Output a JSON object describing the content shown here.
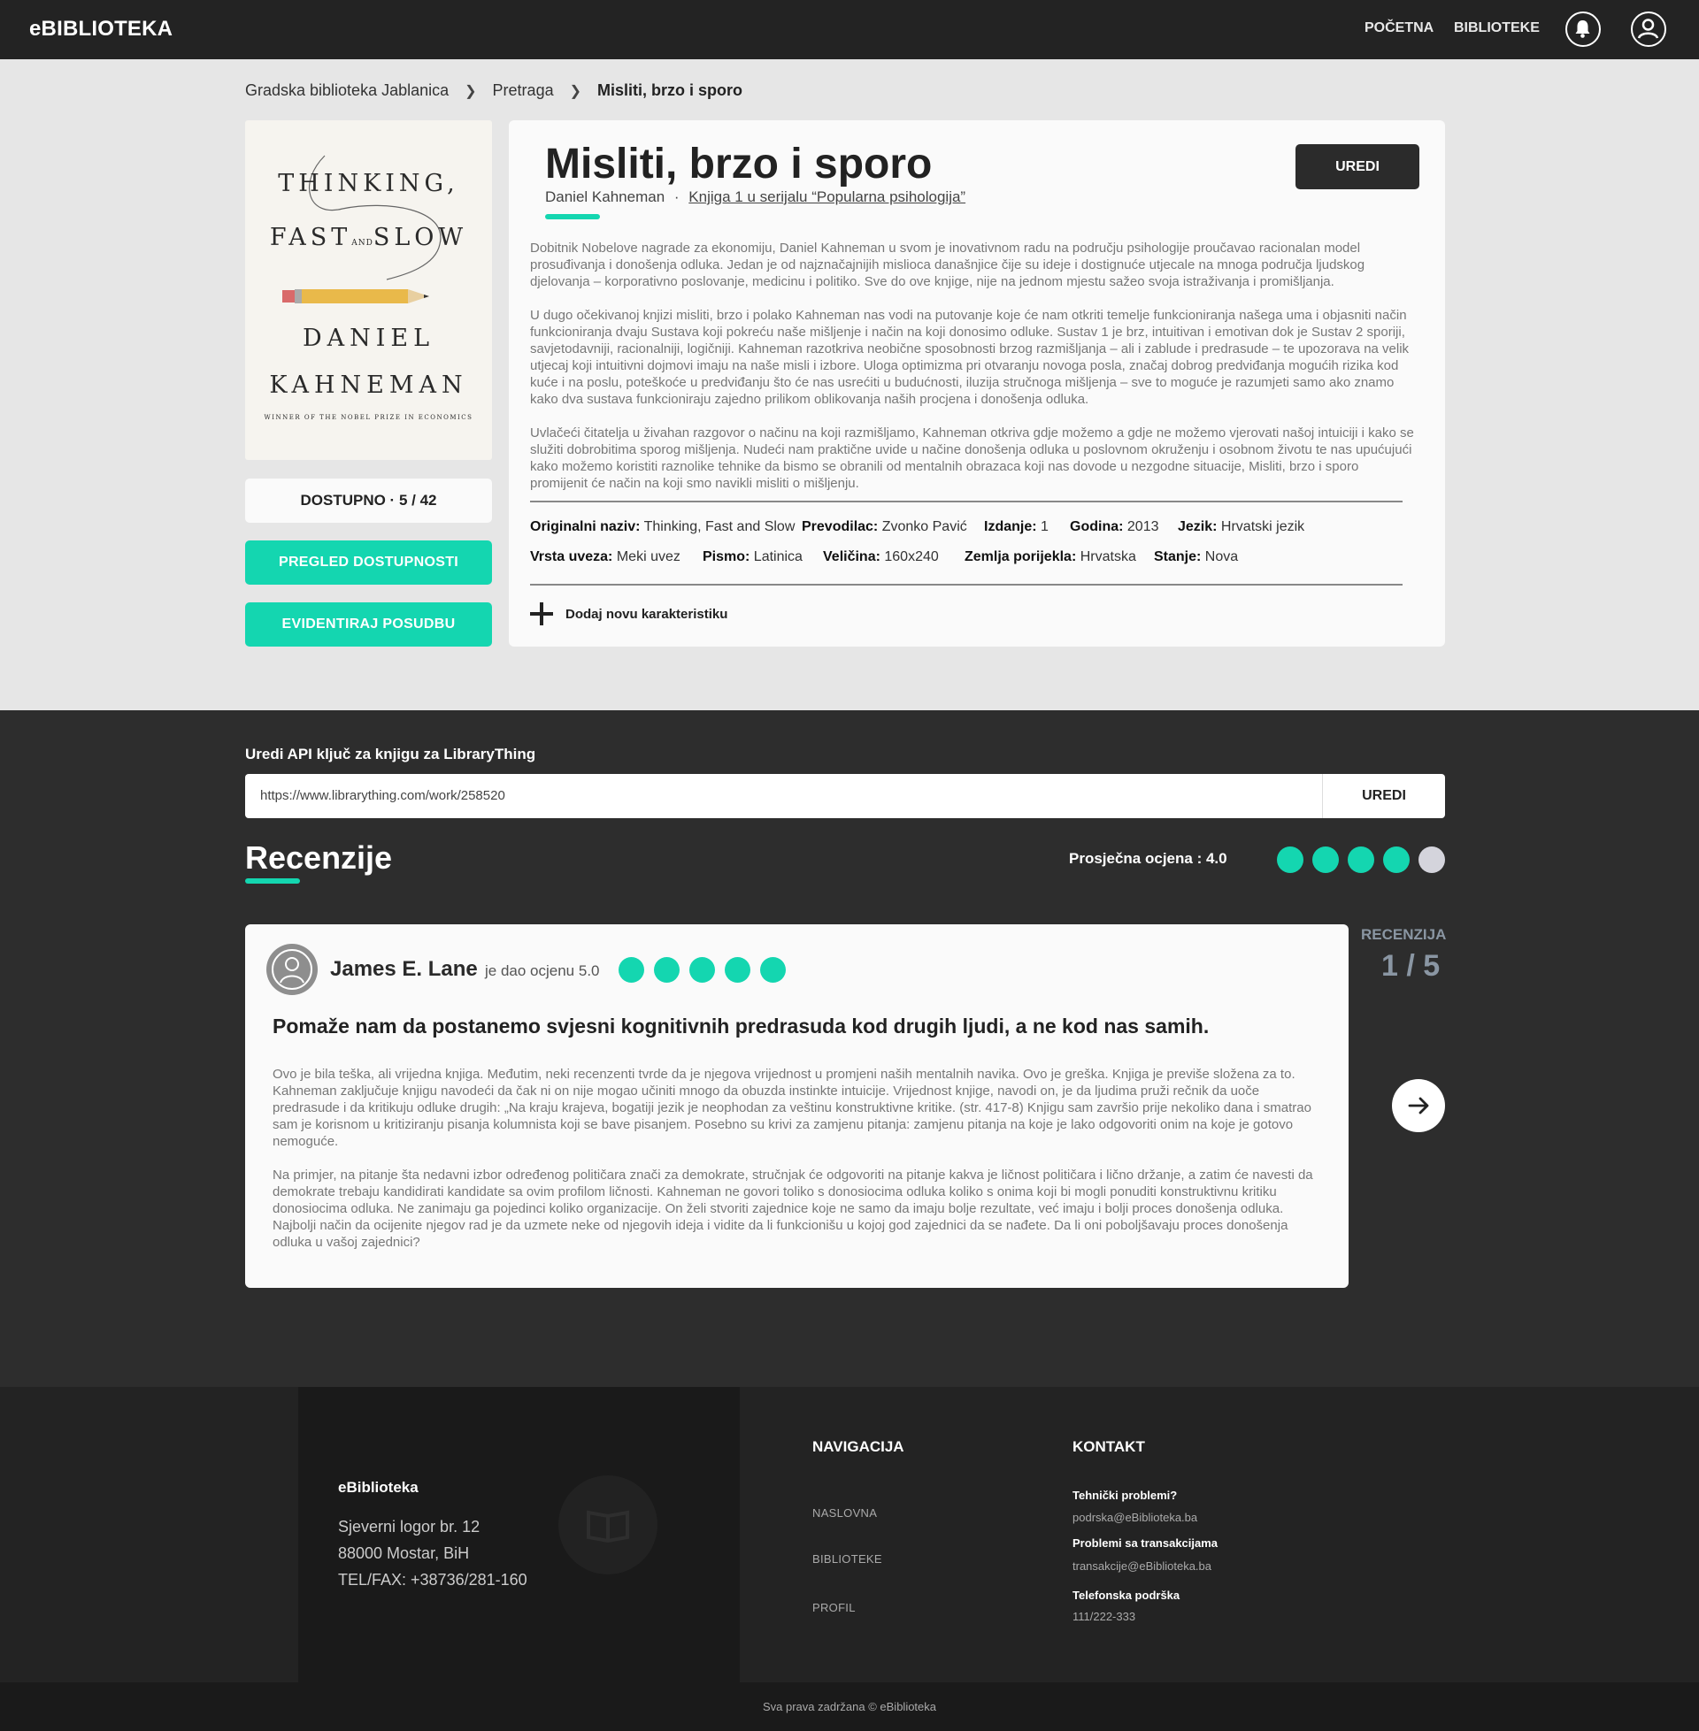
{
  "header": {
    "logo": "eBIBLIOTEKA",
    "nav": [
      "POČETNA",
      "BIBLIOTEKE"
    ],
    "icons": [
      "bell-icon",
      "user-icon"
    ]
  },
  "breadcrumb": [
    "Gradska biblioteka Jablanica",
    "Pretraga",
    "Misliti, brzo i sporo"
  ],
  "cover": {
    "line1": "THINKING,",
    "line2a": "FAST",
    "line2b": "AND",
    "line2c": "SLOW",
    "author1": "DANIEL",
    "author2": "KAHNEMAN",
    "subtitle": "WINNER OF THE NOBEL PRIZE IN ECONOMICS"
  },
  "availability": "DOSTUPNO · 5 / 42",
  "actions": {
    "pregled": "PREGLED DOSTUPNOSTI",
    "evidentiraj": "EVIDENTIRAJ  POSUDBU"
  },
  "book": {
    "title": "Misliti, brzo i sporo",
    "author": "Daniel Kahneman",
    "separator": "·",
    "series": "Knjiga 1 u serijalu “Popularna psihologija”",
    "edit_label": "UREDI",
    "description": [
      "Dobitnik Nobelove nagrade za ekonomiju, Daniel Kahneman u svom je inovativnom radu na području psihologije proučavao racionalan model prosuđivanja i donošenja odluka. Jedan je od najznačajnijih mislioca današnjice čije su ideje i dostignuće utjecale na mnoga područja ljudskog djelovanja – korporativno poslovanje, medicinu i politiko. Sve do ove knjige, nije na jednom mjestu sažeo svoja istraživanja i promišljanja.",
      "U dugo očekivanoj knjizi misliti, brzo i polako Kahneman nas vodi na putovanje koje će nam otkriti temelje funkcioniranja našega uma i objasniti način funkcioniranja dvaju Sustava koji pokreću naše mišljenje i način na koji donosimo odluke. Sustav 1 je brz, intuitivan i emotivan dok je Sustav 2 sporiji, savjetodavniji, racionalniji, logičniji. Kahneman razotkriva neobične sposobnosti brzog razmišljanja – ali i zablude i predrasude – te upozorava na velik utjecaj koji intuitivni dojmovi imaju na naše misli i izbore. Uloga optimizma pri otvaranju novoga posla, značaj dobrog predviđanja mogućih rizika kod kuće i na poslu, poteškoće u predviđanju što će nas usrećiti u budućnosti, iluzija stručnoga mišljenja – sve to moguće je razumjeti samo ako znamo kako dva sustava funkcioniraju zajedno prilikom oblikovanja naših procjena i donošenja odluka.",
      "Uvlačeći čitatelja u živahan razgovor o načinu na koji razmišljamo, Kahneman otkriva gdje možemo a gdje ne možemo vjerovati našoj intuiciji i kako se služiti dobrobitima sporog mišljenja. Nudeći nam praktične uvide u načine donošenja odluka u poslovnom okruženju i osobnom životu te nas upućujući kako možemo koristiti raznolike tehnike da bismo se obranili od mentalnih obrazaca koji nas dovode u nezgodne situacije, Misliti, brzo i sporo promijenit će način na koji smo navikli misliti o mišljenju."
    ],
    "attributes_row1": [
      {
        "label": "Originalni naziv:",
        "value": "Thinking, Fast and Slow"
      },
      {
        "label": "Prevodilac:",
        "value": "Zvonko Pavić"
      },
      {
        "label": "Izdanje:",
        "value": "1"
      },
      {
        "label": "Godina:",
        "value": "2013"
      },
      {
        "label": "Jezik:",
        "value": "Hrvatski jezik"
      }
    ],
    "attributes_row2": [
      {
        "label": "Vrsta uveza:",
        "value": "Meki uvez"
      },
      {
        "label": "Pismo:",
        "value": "Latinica"
      },
      {
        "label": "Veličina:",
        "value": "160x240"
      },
      {
        "label": "Zemlja porijekla:",
        "value": "Hrvatska"
      },
      {
        "label": "Stanje:",
        "value": "Nova"
      }
    ],
    "add_characteristic": "Dodaj novu karakteristiku"
  },
  "api": {
    "label": "Uredi API ključ za knjigu za LibraryThing",
    "value": "https://www.librarything.com/work/258520",
    "button": "UREDI"
  },
  "reviews": {
    "heading": "Recenzije",
    "average_label": "Prosječna ocjena : 4.0",
    "average_rating": 4,
    "max_rating": 5,
    "counter_label": "RECENZIJA",
    "counter": "1 / 5",
    "current": {
      "reviewer": "James E. Lane",
      "rated_text": "je dao ocjenu 5.0",
      "rating": 5,
      "title": "Pomaže nam da postanemo svjesni kognitivnih predrasuda kod drugih ljudi, a ne kod nas samih.",
      "body": [
        "Ovo je bila teška, ali vrijedna knjiga. Međutim, neki recenzenti tvrde da je njegova vrijednost u promjeni naših mentalnih navika. Ovo je greška. Knjiga je previše složena za to. Kahneman zaključuje knjigu navodeći da čak ni on nije mogao učiniti mnogo da obuzda instinkte intuicije. Vrijednost knjige, navodi on, je da ljudima pruži rečnik da uoče predrasude i da kritikuju odluke drugih: „Na kraju krajeva, bogatiji jezik je neophodan za veštinu konstruktivne kritike. (str. 417-8) Knjigu sam završio prije nekoliko dana i smatrao sam je korisnom u kritiziranju pisanja kolumnista koji se bave pisanjem. Posebno su krivi za zamjenu pitanja: zamjenu pitanja na koje je lako odgovoriti onim na koje je gotovo nemoguće.",
        "Na primjer, na pitanje šta nedavni izbor određenog političara znači za demokrate, stručnjak će odgovoriti na pitanje kakva je ličnost političara i lično držanje, a zatim će navesti da demokrate trebaju kandidirati kandidate sa ovim profilom ličnosti. Kahneman ne govori toliko s donosiocima odluka koliko s onima koji bi mogli ponuditi konstruktivnu kritiku donosiocima odluka. Ne zanimaju ga pojedinci koliko organizacije. On želi stvoriti zajednice koje ne samo da imaju bolje rezultate, već imaju i bolji proces donošenja odluka. Najbolji način da ocijenite njegov rad je da uzmete neke od njegovih ideja i vidite da li funkcionišu u kojoj god zajednici da se nađete. Da li oni poboljšavaju proces donošenja odluka u vašoj zajednici?"
      ]
    }
  },
  "footer": {
    "brand": "eBiblioteka",
    "address1": "Sjeverni logor br. 12",
    "address2": "88000 Mostar, BiH",
    "phone": "TEL/FAX: +38736/281-160",
    "nav_heading": "NAVIGACIJA",
    "nav_items": [
      "NASLOVNA",
      "BIBLIOTEKE",
      "PROFIL"
    ],
    "contact_heading": "KONTAKT",
    "contacts": [
      {
        "title": "Tehnički problemi?",
        "value": "podrska@eBiblioteka.ba"
      },
      {
        "title": "Problemi sa transakcijama",
        "value": "transakcije@eBiblioteka.ba"
      },
      {
        "title": "Telefonska podrška",
        "value": "111/222-333"
      }
    ],
    "copyright": "Sva prava zadržana © eBiblioteka"
  },
  "colors": {
    "accent": "#14d6b0",
    "header_bg": "#232323",
    "dark_section": "#2d2d2d",
    "page_bg": "#e6e6e6"
  }
}
